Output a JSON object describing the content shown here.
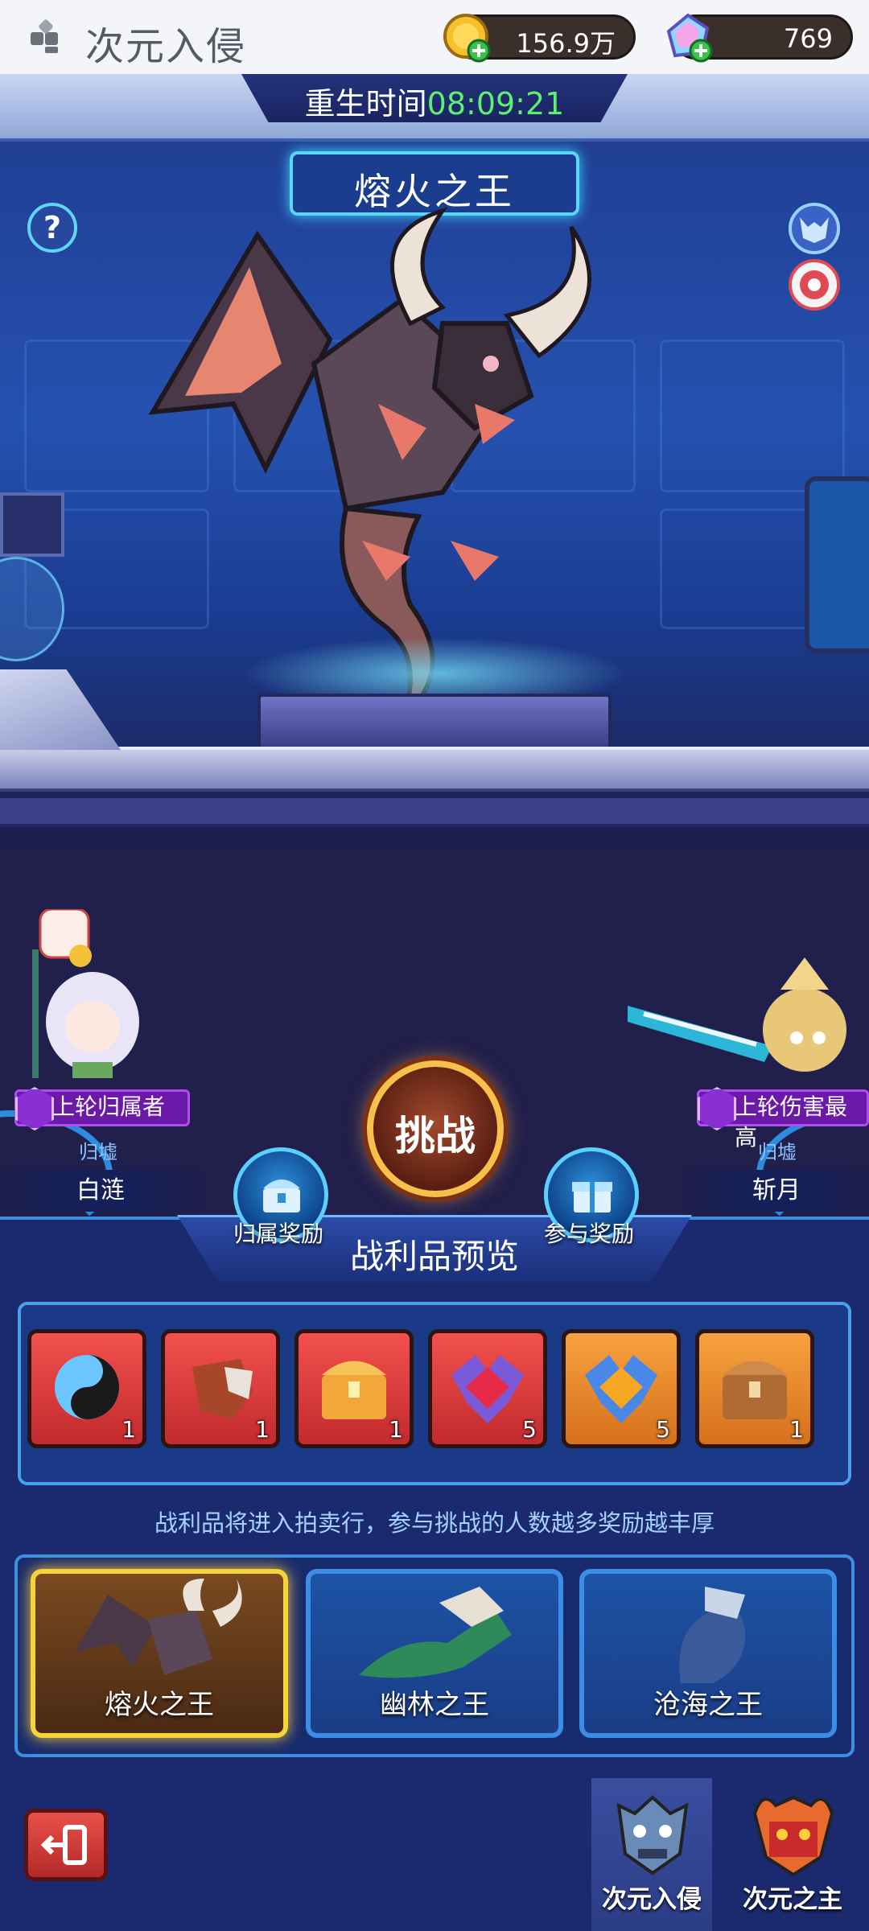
{
  "app": {
    "title": "次元入侵"
  },
  "resources": {
    "gold": "156.9万",
    "gems": "769"
  },
  "arena": {
    "respawn_label": "重生时间",
    "respawn_time": "08:09:21",
    "boss_name": "熔火之王",
    "help_label": "?"
  },
  "players": {
    "left": {
      "tag": "上轮归属者",
      "guild": "归墟",
      "name": "白涟"
    },
    "right": {
      "tag": "上轮伤害最高",
      "guild": "归墟",
      "name": "斩月"
    }
  },
  "actions": {
    "challenge": "挑战",
    "ownership_reward": "归属奖励",
    "participation_reward": "参与奖励"
  },
  "loot": {
    "title": "战利品预览",
    "items": [
      {
        "icon": "yin-yang-orb-icon",
        "qty": "1",
        "rarity": "red"
      },
      {
        "icon": "dragon-armor-icon",
        "qty": "1",
        "rarity": "red"
      },
      {
        "icon": "treasure-chest-icon",
        "qty": "1",
        "rarity": "red"
      },
      {
        "icon": "ruby-crest-icon",
        "qty": "5",
        "rarity": "red"
      },
      {
        "icon": "topaz-crest-icon",
        "qty": "5",
        "rarity": "orange"
      },
      {
        "icon": "wooden-chest-icon",
        "qty": "1",
        "rarity": "orange"
      }
    ],
    "note": "战利品将进入拍卖行，参与挑战的人数越多奖励越丰厚"
  },
  "bosses": [
    {
      "name": "熔火之王",
      "selected": true
    },
    {
      "name": "幽林之王",
      "selected": false
    },
    {
      "name": "沧海之王",
      "selected": false
    }
  ],
  "tabs": [
    {
      "label": "次元入侵",
      "active": true
    },
    {
      "label": "次元之主",
      "active": false
    }
  ],
  "colors": {
    "accent": "#3c8de6",
    "timer": "#5ef070",
    "tag": "#6a1aa6",
    "selected": "#f7d33a"
  }
}
